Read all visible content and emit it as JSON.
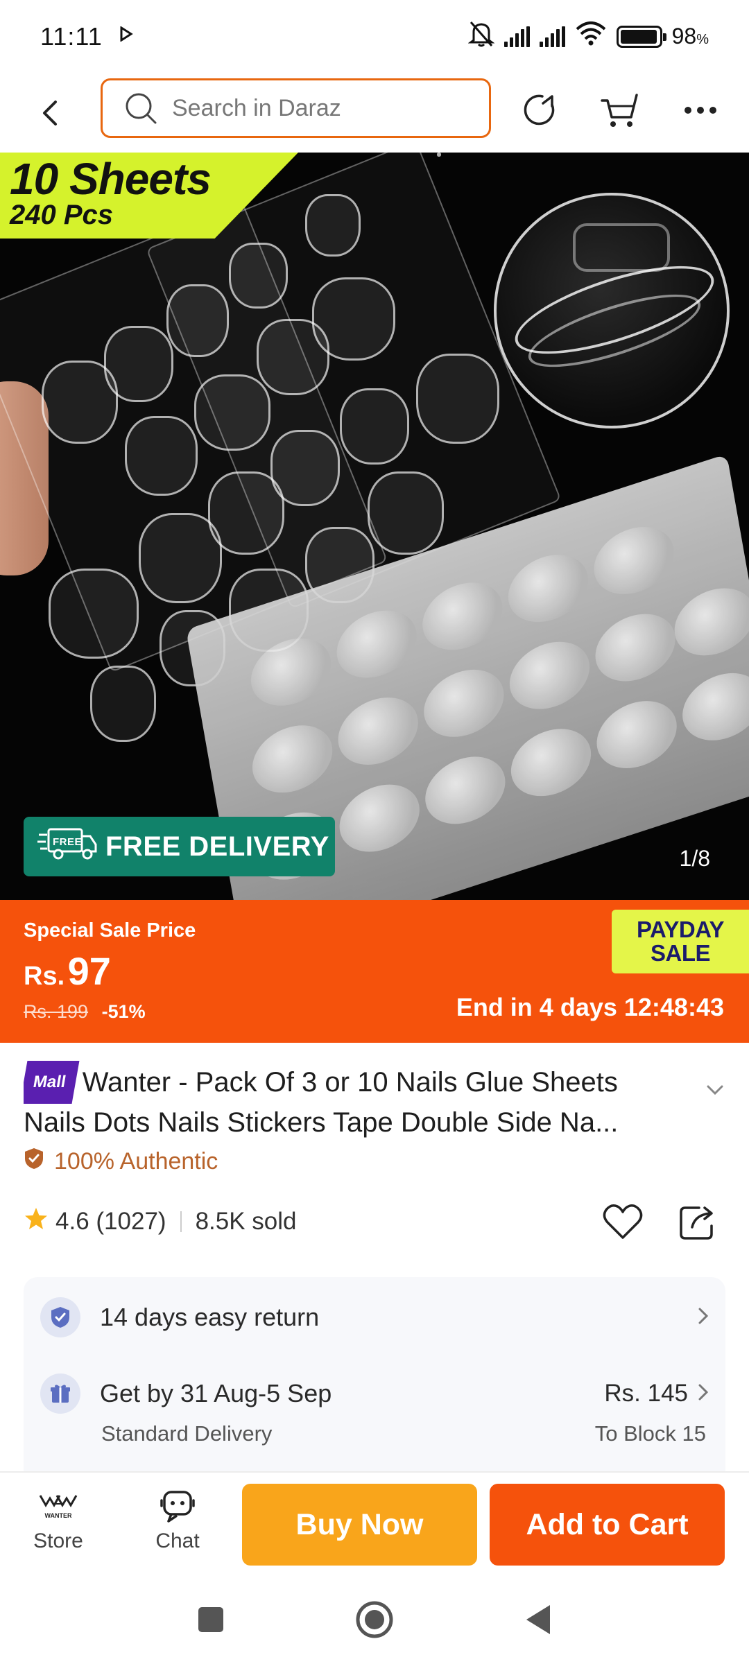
{
  "status_bar": {
    "time": "11:11",
    "battery_percent": "98",
    "battery_unit": "%"
  },
  "search": {
    "placeholder": "Search in Daraz"
  },
  "product_image": {
    "badge_line1": "10 Sheets",
    "badge_line2": "240 Pcs",
    "free_delivery": "FREE DELIVERY",
    "free_tag": "FREE",
    "counter": "1/8"
  },
  "price": {
    "label": "Special Sale Price",
    "currency": "Rs.",
    "amount": "97",
    "original": "Rs. 199",
    "discount": "-51%",
    "campaign_line1": "PAYDAY",
    "campaign_line2": "SALE",
    "countdown": "End in 4 days 12:48:43"
  },
  "product": {
    "mall_badge": "Mall",
    "title": "Wanter - Pack Of 3 or 10 Nails Glue Sheets Nails Dots Nails Stickers Tape Double Side Na...",
    "authentic": "100% Authentic",
    "rating": "4.6",
    "reviews": "(1027)",
    "sold": "8.5K sold"
  },
  "services": {
    "return_text": "14 days easy return",
    "delivery_text": "Get by 31 Aug-5 Sep",
    "delivery_type": "Standard Delivery",
    "delivery_price": "Rs. 145",
    "delivery_location": "To Block 15"
  },
  "bottom_bar": {
    "store_logo": "WANTER",
    "store_label": "Store",
    "chat_label": "Chat",
    "buy_now": "Buy Now",
    "add_to_cart": "Add to Cart"
  },
  "colors": {
    "brand_orange": "#f5520c",
    "buy_now_yellow": "#f9a51b",
    "search_border": "#e8670f",
    "free_delivery_green": "#11826a",
    "mall_purple": "#5a1fb0",
    "authentic_brown": "#b8632b"
  }
}
